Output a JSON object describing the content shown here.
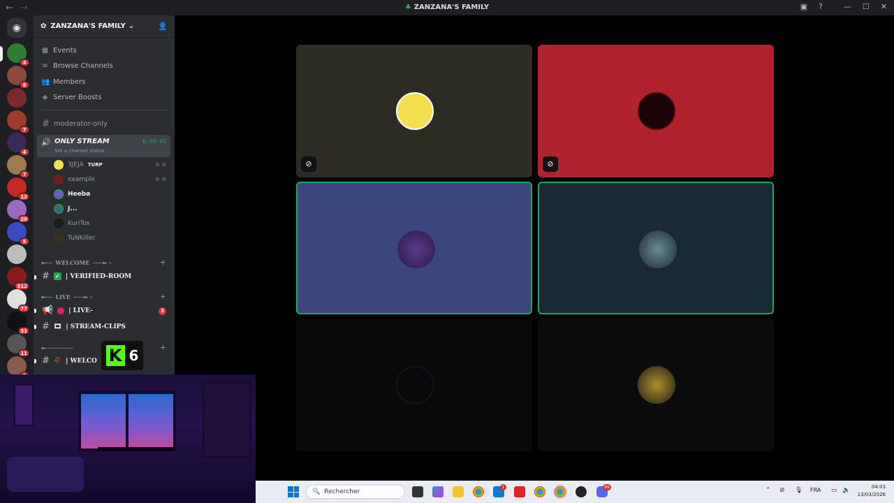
{
  "window": {
    "title": "ZANZANA'S FAMILY",
    "back_icon": "arrow-left-icon",
    "forward_icon": "arrow-right-icon"
  },
  "server": {
    "name": "ZANZANA'S FAMILY",
    "menu": [
      {
        "label": "Events",
        "icon": "calendar-icon"
      },
      {
        "label": "Browse Channels",
        "icon": "browse-icon"
      },
      {
        "label": "Members",
        "icon": "members-icon"
      },
      {
        "label": "Server Boosts",
        "icon": "boost-icon"
      }
    ]
  },
  "rail": {
    "badges": [
      "4",
      "6",
      "7",
      "4",
      "7",
      "12",
      "20",
      "5",
      "312",
      "77",
      "31",
      "11",
      "3"
    ]
  },
  "channels": {
    "moderator": "moderator-only",
    "stream": {
      "name": "ONLY STREAM",
      "timer": "6:59:02",
      "status": "Set a channel status"
    },
    "voice_users": [
      {
        "name": "3JEJA",
        "tag": "TURP"
      },
      {
        "name": "example"
      },
      {
        "name": "Heeba"
      },
      {
        "name": "J..."
      },
      {
        "name": "KuriTox"
      },
      {
        "name": "TuNKiller"
      }
    ],
    "categories": {
      "welcome": "WELCOME",
      "live": "LIVE"
    },
    "verified": "| VERIFIED-ROOM",
    "live": "| LIVE-",
    "live_badge": "3",
    "clips": "| STREAM-CLIPS",
    "welcome": "| WELCO"
  },
  "kick": {
    "count": "6"
  },
  "tiles": [
    {
      "bg": "#2c2c24",
      "muted": true
    },
    {
      "bg": "#b0222d",
      "muted": true
    },
    {
      "bg": "#3b4580",
      "muted": false,
      "speaking": true
    },
    {
      "bg": "#192a34",
      "muted": false,
      "speaking": true
    },
    {
      "bg": "#0a0a0c",
      "muted": false
    },
    {
      "bg": "#0c0c0c",
      "muted": false
    }
  ],
  "taskbar": {
    "search_placeholder": "Rechercher",
    "notif_badge": "1",
    "discord_badge": "99",
    "lang": "FRA",
    "time": "04:03",
    "date": "13/03/2026"
  }
}
